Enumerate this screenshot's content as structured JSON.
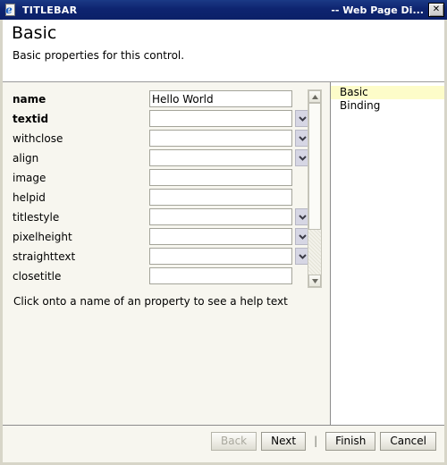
{
  "window": {
    "icon": "web-page-icon",
    "title": "TITLEBAR",
    "right_title": "-- Web Page Di...",
    "close_label": "✕"
  },
  "header": {
    "title": "Basic",
    "subtitle": "Basic properties for this control."
  },
  "properties": {
    "rows": [
      {
        "label": "name",
        "bold": true,
        "value": "Hello World",
        "dropdown": false
      },
      {
        "label": "textid",
        "bold": true,
        "value": "",
        "dropdown": true
      },
      {
        "label": "withclose",
        "bold": false,
        "value": "",
        "dropdown": true
      },
      {
        "label": "align",
        "bold": false,
        "value": "",
        "dropdown": true
      },
      {
        "label": "image",
        "bold": false,
        "value": "",
        "dropdown": false
      },
      {
        "label": "helpid",
        "bold": false,
        "value": "",
        "dropdown": false
      },
      {
        "label": "titlestyle",
        "bold": false,
        "value": "",
        "dropdown": true
      },
      {
        "label": "pixelheight",
        "bold": false,
        "value": "",
        "dropdown": true
      },
      {
        "label": "straighttext",
        "bold": false,
        "value": "",
        "dropdown": true
      },
      {
        "label": "closetitle",
        "bold": false,
        "value": "",
        "dropdown": false
      }
    ],
    "help_text": "Click onto a name of an property to see a help text",
    "scrollbar": {
      "up_icon": "triangle-up-icon",
      "down_icon": "triangle-down-icon"
    }
  },
  "categories": {
    "items": [
      {
        "label": "Basic",
        "selected": true
      },
      {
        "label": "Binding",
        "selected": false
      }
    ]
  },
  "footer": {
    "buttons": [
      {
        "label": "Back",
        "disabled": true
      },
      {
        "label": "Next",
        "disabled": false
      }
    ],
    "separator": "|",
    "buttons2": [
      {
        "label": "Finish",
        "disabled": false
      },
      {
        "label": "Cancel",
        "disabled": false
      }
    ]
  },
  "colors": {
    "titlebar": "#0e2470",
    "selection": "#fdfcc9",
    "dropdown_button": "#d6d6e4",
    "panel": "#f7f6ef"
  }
}
